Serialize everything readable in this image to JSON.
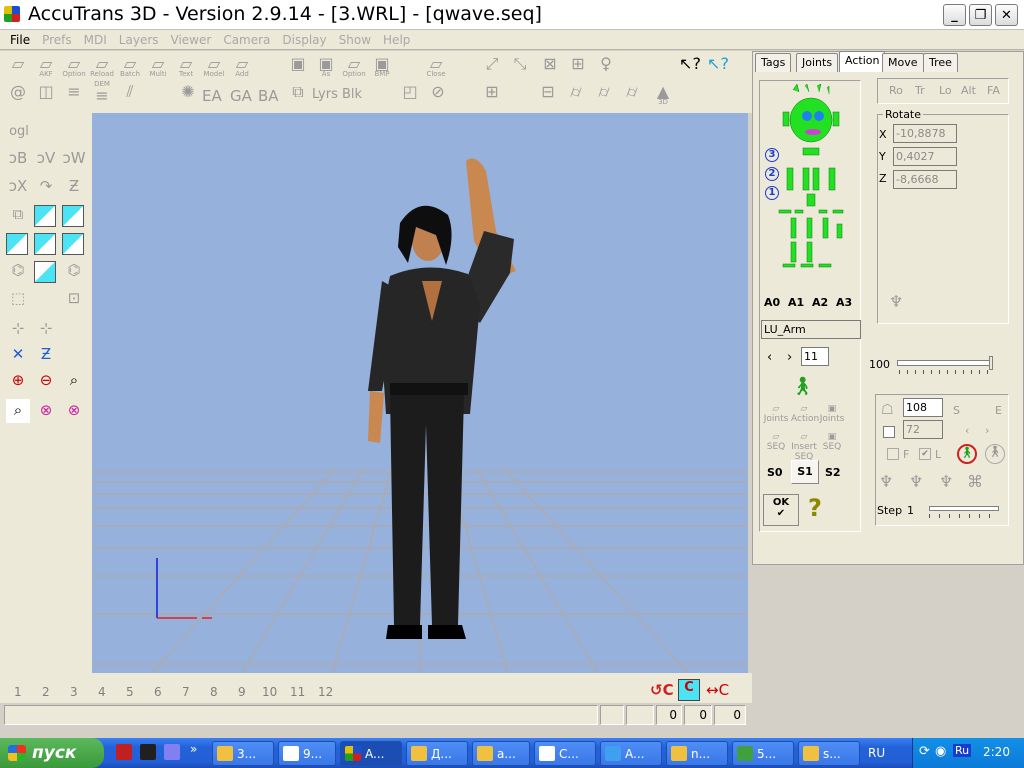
{
  "window": {
    "title": "AccuTrans 3D - Version 2.9.14 - [3.WRL] - [qwave.seq]",
    "minimize_glyph": "_",
    "restore_glyph": "❐",
    "close_glyph": "✕"
  },
  "menu": [
    "File",
    "Prefs",
    "MDI",
    "Layers",
    "Viewer",
    "Camera",
    "Display",
    "Show",
    "Help"
  ],
  "toolbar": {
    "row1_labels": [
      "AKF",
      "Option",
      "Reload",
      "Batch",
      "Multi",
      "Text",
      "Model",
      "Add",
      "As",
      "Option",
      "BMP",
      "Close"
    ],
    "row2_labels": [
      "DEM",
      "EA",
      "GA",
      "BA",
      "Lyrs",
      "Blk",
      "3D"
    ],
    "left_text": "ogl"
  },
  "frames": [
    "1",
    "2",
    "3",
    "4",
    "5",
    "6",
    "7",
    "8",
    "9",
    "10",
    "11",
    "12"
  ],
  "status": {
    "v1": "0",
    "v2": "0",
    "v3": "0"
  },
  "panel": {
    "tabs": [
      "Tags",
      "Joints",
      "Action",
      "Move",
      "Tree"
    ],
    "active_tab": "Action",
    "mode_buttons": [
      "Ro",
      "Tr",
      "Lo",
      "Alt",
      "FA"
    ],
    "rotate_label": "Rotate",
    "rotate": {
      "x_label": "X",
      "x": "-10,8878",
      "y_label": "Y",
      "y": "0,4027",
      "z_label": "Z",
      "z": "-8,6668"
    },
    "levels": [
      "3",
      "2",
      "1"
    ],
    "anim_buttons": [
      "A0",
      "A1",
      "A2",
      "A3"
    ],
    "joint_name": "LU_Arm",
    "joint_index": "11",
    "slider_value": "100",
    "small_buttons": [
      "Joints",
      "Action",
      "Joints",
      "SEQ",
      "Insert SEQ",
      "SEQ"
    ],
    "seq_buttons": [
      "S0",
      "S1",
      "S2"
    ],
    "ok_label": "OK",
    "help_label": "?",
    "frame_start": "108",
    "frame_end": "72",
    "s_label": "S",
    "e_label": "E",
    "f_label": "F",
    "l_label": "L",
    "step_label": "Step",
    "step_value": "1"
  },
  "taskbar": {
    "start": "пуск",
    "tasks": [
      "3...",
      "9...",
      "A...",
      "Д...",
      "a...",
      "C...",
      "A...",
      "n...",
      "5...",
      "s..."
    ],
    "lang": "RU",
    "tray_lang": "Ru",
    "clock": "2:20"
  },
  "colors": {
    "viewport": "#96b1dc",
    "skeleton": "#22e022",
    "accent": "#4ce4f4"
  }
}
